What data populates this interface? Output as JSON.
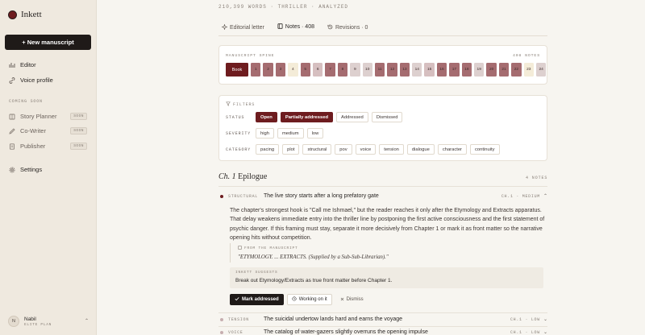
{
  "app": {
    "name": "Inkett"
  },
  "sidebar": {
    "new_button": "+ New manuscript",
    "nav": [
      {
        "label": "Editor",
        "icon": "chart-icon"
      },
      {
        "label": "Voice profile",
        "icon": "link-icon"
      }
    ],
    "coming_soon_label": "COMING SOON",
    "coming_soon": [
      {
        "label": "Story Planner",
        "badge": "SOON"
      },
      {
        "label": "Co-Writer",
        "badge": "SOON"
      },
      {
        "label": "Publisher",
        "badge": "SOON"
      }
    ],
    "settings": "Settings",
    "user": {
      "initial": "N",
      "name": "Nabil",
      "plan": "ELITE PLAN"
    }
  },
  "main": {
    "meta": "210,399 WORDS · THRILLER · ANALYZED",
    "tabs": [
      {
        "label": "Editorial letter"
      },
      {
        "label": "Notes · 408"
      },
      {
        "label": "Revisions · 0"
      }
    ],
    "spine": {
      "label": "MANUSCRIPT SPINE",
      "count": "408 NOTES",
      "book": "Book",
      "cells": [
        "1",
        "2",
        "3",
        "4",
        "5",
        "6",
        "7",
        "8",
        "9",
        "10",
        "11",
        "12",
        "13",
        "14",
        "15",
        "16",
        "17",
        "18",
        "19",
        "20",
        "21",
        "22",
        "23",
        "24"
      ],
      "colors": [
        "#a56c70",
        "#a56c70",
        "#a56c70",
        "#f4ecd8",
        "#a56c70",
        "#d6bfc0",
        "#a56c70",
        "#a56c70",
        "#ddd0cf",
        "#ddd0cf",
        "#a56c70",
        "#a56c70",
        "#a56c70",
        "#ddd0cf",
        "#d6bfc0",
        "#a56c70",
        "#a56c70",
        "#a56c70",
        "#ddd0cf",
        "#a56c70",
        "#a56c70",
        "#a56c70",
        "#f4ecd8",
        "#ddd0cf"
      ]
    },
    "filters": {
      "title": "FILTERS",
      "status_label": "STATUS",
      "status": [
        "Open",
        "Partially addressed",
        "Addressed",
        "Dismissed"
      ],
      "severity_label": "SEVERITY",
      "severity": [
        "high",
        "medium",
        "low"
      ],
      "category_label": "CATEGORY",
      "category": [
        "pacing",
        "plot",
        "structural",
        "pov",
        "voice",
        "tension",
        "dialogue",
        "character",
        "continuity"
      ]
    },
    "chapter": {
      "num": "Ch. 1",
      "name": "Epilogue",
      "count": "4 NOTES"
    },
    "notes": [
      {
        "type": "STRUCTURAL",
        "title": "The live story starts after a long prefatory gate",
        "tag": "CH.1 · MEDIUM",
        "chev": "⌃"
      },
      {
        "type": "TENSION",
        "title": "The suicidal undertow lands hard and earns the voyage",
        "tag": "CH.1 · LOW",
        "chev": "⌄"
      },
      {
        "type": "VOICE",
        "title": "The catalog of water-gazers slightly overruns the opening impulse",
        "tag": "CH.1 · LOW",
        "chev": "⌄"
      }
    ],
    "note_body": "The chapter's strongest hook is \"Call me Ishmael,\" but the reader reaches it only after the Etymology and Extracts apparatus. That delay weakens immediate entry into the thriller line by postponing the first active consciousness and the first statement of psychic danger. If this framing must stay, separate it more decisively from Chapter 1 or mark it as front matter so the narrative opening hits without competition.",
    "quote_label": "FROM THE MANUSCRIPT",
    "quote": "\"ETYMOLOGY. ... EXTRACTS. (Supplied by a Sub-Sub-Librarian).\"",
    "suggest_label": "INKETT SUGGESTS",
    "suggest_text": "Break out Etymology/Extracts as true front matter before Chapter 1.",
    "actions": {
      "mark": "Mark addressed",
      "working": "Working on it",
      "dismiss": "Dismiss"
    }
  }
}
